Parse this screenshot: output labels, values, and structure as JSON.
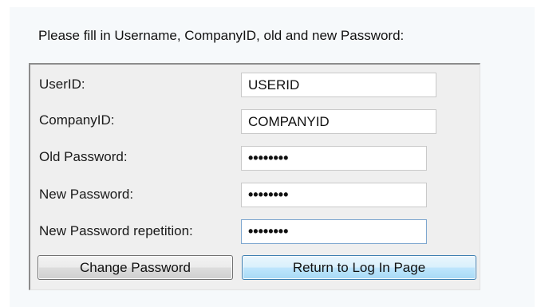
{
  "form": {
    "instructions": "Please fill in Username, CompanyID, old and new Password:",
    "fields": [
      {
        "label": "UserID:",
        "value": "USERID",
        "type": "text"
      },
      {
        "label": "CompanyID:",
        "value": "COMPANYID",
        "type": "text"
      },
      {
        "label": "Old Password:",
        "value": "••••••••",
        "type": "password"
      },
      {
        "label": "New Password:",
        "value": "••••••••",
        "type": "password"
      },
      {
        "label": "New Password repetition:",
        "value": "••••••••",
        "type": "password"
      }
    ],
    "buttons": {
      "change_password": "Change Password",
      "return_to_login": "Return to Log In Page"
    }
  }
}
